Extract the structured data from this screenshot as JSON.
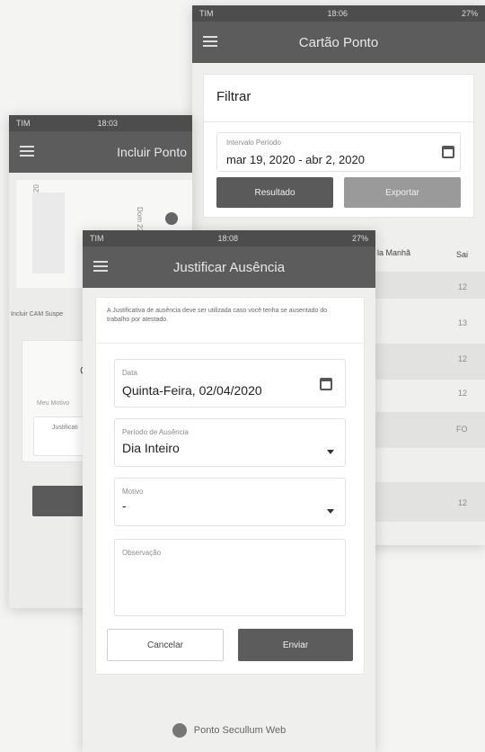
{
  "back_phone": {
    "status": {
      "carrier": "TIM",
      "time": "18:06",
      "battery": "27%"
    },
    "title": "Cartão Ponto",
    "filter": {
      "heading": "Filtrar",
      "period_label": "Intervalo Período",
      "period_value": "mar 19, 2020 - abr 2, 2020",
      "btn_left": "Resultado",
      "btn_right": "Exportar"
    },
    "table": {
      "header_left": "la Manhã",
      "header_right": "Sai",
      "cells": [
        "12",
        "13",
        "12",
        "12",
        "FO",
        "12"
      ]
    }
  },
  "middle_phone": {
    "status": {
      "carrier": "TIM",
      "time": "18:03"
    },
    "title": "Incluir Ponto",
    "chart_labels": [
      "Sex 20",
      "Dom 22"
    ],
    "row_label": "Incluir CAM Suspe",
    "sub_label": "Meu Motivo",
    "field_label": "Justificati",
    "char": "C"
  },
  "front_phone": {
    "status": {
      "carrier": "TIM",
      "time": "18:08",
      "battery": "27%"
    },
    "title": "Justificar Ausência",
    "intro": "A Justificativa de ausência deve ser utilizada caso você tenha se ausentado do trabalho por atestado.",
    "date_field": {
      "label": "Data",
      "value": "Quinta-Feira, 02/04/2020"
    },
    "period_field": {
      "label": "Período de Ausência",
      "value": "Dia Inteiro"
    },
    "reason_field": {
      "label": "Motivo",
      "value": "-"
    },
    "notes_field": {
      "label": "Observação",
      "value": ""
    },
    "cancel": "Cancelar",
    "send": "Enviar",
    "footer": "Ponto Secullum Web"
  }
}
